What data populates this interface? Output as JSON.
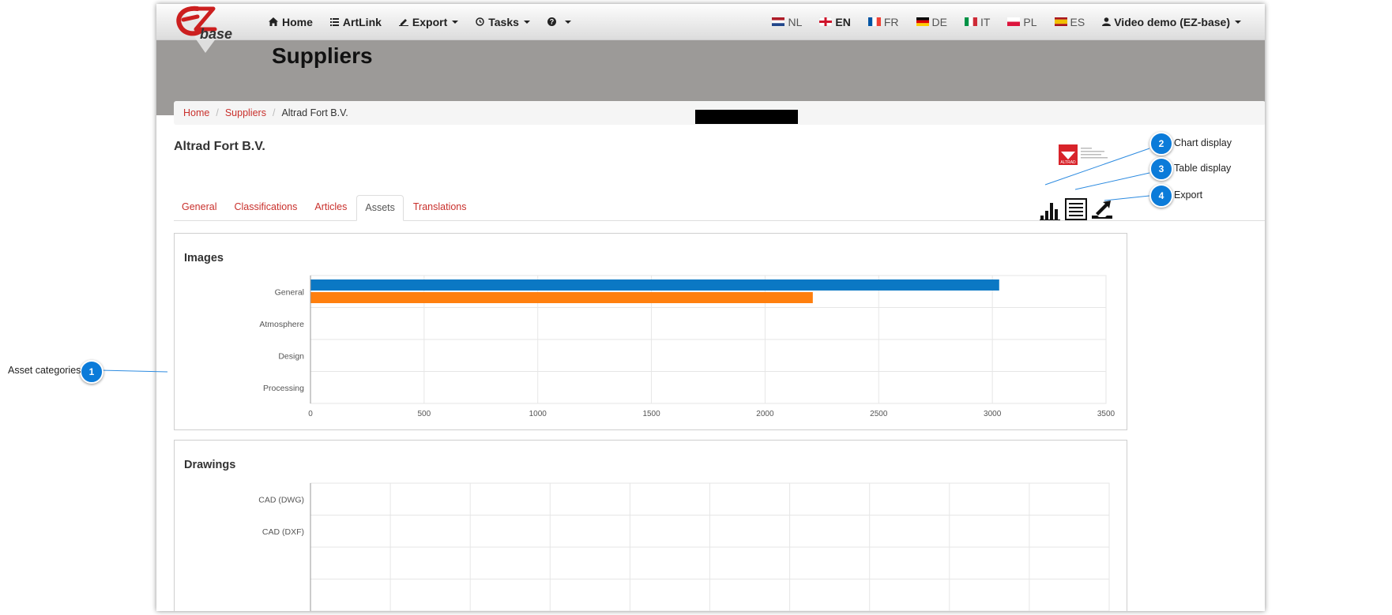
{
  "nav": {
    "items": [
      {
        "label": "Home",
        "icon": "home-icon"
      },
      {
        "label": "ArtLink",
        "icon": "list-icon"
      },
      {
        "label": "Export",
        "icon": "pencil-icon",
        "dropdown": true
      },
      {
        "label": "Tasks",
        "icon": "clock-icon",
        "dropdown": true
      },
      {
        "label": "",
        "icon": "help-icon",
        "dropdown": true
      }
    ],
    "languages": [
      {
        "code": "NL",
        "active": false
      },
      {
        "code": "EN",
        "active": true
      },
      {
        "code": "FR",
        "active": false
      },
      {
        "code": "DE",
        "active": false
      },
      {
        "code": "IT",
        "active": false
      },
      {
        "code": "PL",
        "active": false
      },
      {
        "code": "ES",
        "active": false
      }
    ],
    "user": "Video demo (EZ-base)"
  },
  "logo": {
    "text": "base"
  },
  "page": {
    "title": "Suppliers"
  },
  "breadcrumb": {
    "home": "Home",
    "suppliers": "Suppliers",
    "current": "Altrad Fort B.V."
  },
  "supplier": {
    "name": "Altrad Fort B.V.",
    "logo_text": "ALTRAD"
  },
  "tabs": [
    {
      "label": "General",
      "active": false
    },
    {
      "label": "Classifications",
      "active": false
    },
    {
      "label": "Articles",
      "active": false
    },
    {
      "label": "Assets",
      "active": true
    },
    {
      "label": "Translations",
      "active": false
    }
  ],
  "colors": {
    "series1": "#0b78c4",
    "series2": "#ff7f0e",
    "link": "#c9302c",
    "callout": "#0b7bd9"
  },
  "chart_data": [
    {
      "type": "bar",
      "orientation": "horizontal",
      "title": "Images",
      "categories": [
        "General",
        "Atmosphere",
        "Design",
        "Processing"
      ],
      "series": [
        {
          "values": [
            3030,
            0,
            0,
            0
          ]
        },
        {
          "values": [
            2210,
            0,
            0,
            0
          ]
        }
      ],
      "xlim": [
        0,
        3500
      ],
      "xticks": [
        0,
        500,
        1000,
        1500,
        2000,
        2500,
        3000,
        3500
      ],
      "grid": true
    },
    {
      "type": "bar",
      "orientation": "horizontal",
      "title": "Drawings",
      "categories": [
        "CAD (DWG)",
        "CAD (DXF)"
      ],
      "grid": true
    }
  ],
  "callouts": [
    {
      "number": "1",
      "label": "Asset categories"
    },
    {
      "number": "2",
      "label": "Chart display"
    },
    {
      "number": "3",
      "label": "Table display"
    },
    {
      "number": "4",
      "label": "Export"
    }
  ]
}
